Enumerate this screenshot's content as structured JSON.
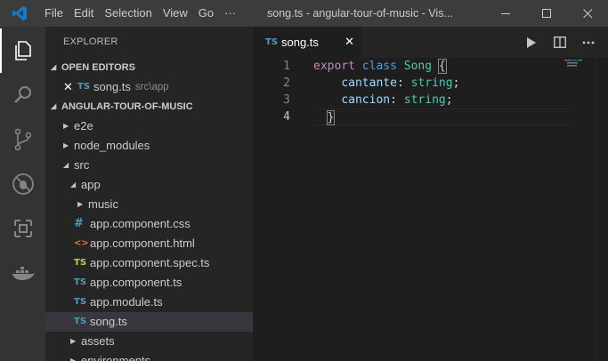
{
  "titlebar": {
    "menu": [
      "File",
      "Edit",
      "Selection",
      "View",
      "Go",
      "···"
    ],
    "window_title": "song.ts - angular-tour-of-music - Vis..."
  },
  "sidebar": {
    "title": "EXPLORER",
    "open_editors_header": "OPEN EDITORS",
    "open_editors": [
      {
        "icon": "TS",
        "name": "song.ts",
        "desc": "src\\app"
      }
    ],
    "project_header": "ANGULAR-TOUR-OF-MUSIC",
    "tree": [
      {
        "label": "e2e",
        "icon": "",
        "twisty": "▶"
      },
      {
        "label": "node_modules",
        "icon": "",
        "twisty": "▶"
      },
      {
        "label": "src",
        "icon": "",
        "twisty": "◢"
      },
      {
        "label": "app",
        "icon": "",
        "twisty": "◢"
      },
      {
        "label": "music",
        "icon": "",
        "twisty": "▶"
      },
      {
        "label": "app.component.css",
        "icon": "#",
        "twisty": ""
      },
      {
        "label": "app.component.html",
        "icon": "<>",
        "twisty": ""
      },
      {
        "label": "app.component.spec.ts",
        "icon": "TS",
        "twisty": ""
      },
      {
        "label": "app.component.ts",
        "icon": "TS",
        "twisty": ""
      },
      {
        "label": "app.module.ts",
        "icon": "TS",
        "twisty": ""
      },
      {
        "label": "song.ts",
        "icon": "TS",
        "twisty": ""
      },
      {
        "label": "assets",
        "icon": "",
        "twisty": "▶"
      },
      {
        "label": "environments",
        "icon": "",
        "twisty": "▶"
      }
    ]
  },
  "editor": {
    "tab": {
      "icon": "TS",
      "label": "song.ts"
    },
    "line_numbers": [
      "1",
      "2",
      "3",
      "4"
    ],
    "code": {
      "l1_kw": "export",
      "l1_kw2": "class",
      "l1_cls": "Song",
      "l1_brace": "{",
      "l2_prop": "cantante",
      "l2_type": "string",
      "l3_prop": "cancion",
      "l3_type": "string",
      "l4_brace": "}"
    }
  },
  "colors": {
    "titlebar": "#3c3c3c",
    "activitybar": "#333333",
    "sidebar": "#252526",
    "editor": "#1e1e1e",
    "accent_blue": "#007acc"
  },
  "icons": {
    "activity": [
      "files-icon",
      "search-icon",
      "source-control-icon",
      "debug-icon",
      "extensions-icon",
      "docker-icon"
    ],
    "editor_actions": [
      "run-icon",
      "split-editor-icon",
      "more-actions-icon"
    ]
  }
}
